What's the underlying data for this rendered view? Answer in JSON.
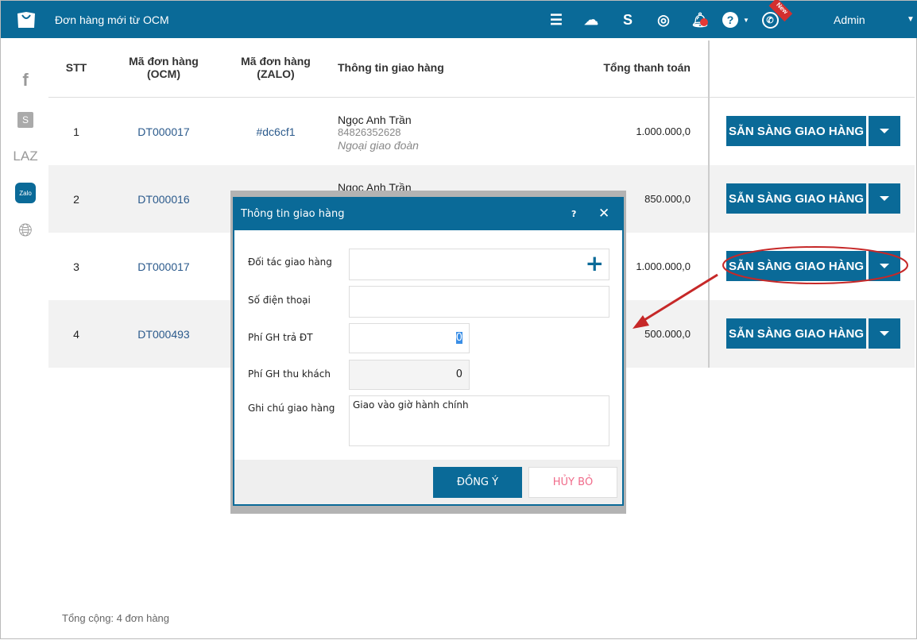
{
  "header": {
    "title": "Đơn hàng mới từ OCM",
    "user": "Admin",
    "new_badge": "New"
  },
  "sidebar": {
    "items": [
      "facebook",
      "shopee",
      "LAZ",
      "Zalo",
      "web"
    ]
  },
  "table": {
    "columns": [
      "STT",
      "Mã đơn hàng\n(OCM)",
      "Mã đơn hàng\n(ZALO)",
      "Thông tin giao hàng",
      "Tổng thanh toán"
    ],
    "rows": [
      {
        "stt": "1",
        "ocm": "DT000017",
        "zalo": "#dc6cf1",
        "name": "Ngọc Anh Trần",
        "phone": "84826352628",
        "address": "Ngoại giao đoàn",
        "total": "1.000.000,0",
        "action": "SẴN SÀNG GIAO HÀNG"
      },
      {
        "stt": "2",
        "ocm": "DT000016",
        "zalo": "",
        "name": "Ngọc Anh Trần",
        "phone": "",
        "address": "",
        "total": "850.000,0",
        "action": "SẴN SÀNG GIAO HÀNG"
      },
      {
        "stt": "3",
        "ocm": "DT000017",
        "zalo": "",
        "name": "",
        "phone": "",
        "address": "",
        "total": "1.000.000,0",
        "action": "SẴN SÀNG GIAO HÀNG"
      },
      {
        "stt": "4",
        "ocm": "DT000493",
        "zalo": "",
        "name": "",
        "phone": "",
        "address": "",
        "total": "500.000,0",
        "action": "SẴN SÀNG GIAO HÀNG"
      }
    ]
  },
  "footer": {
    "total": "Tổng cộng: 4 đơn hàng"
  },
  "modal": {
    "title": "Thông tin giao hàng",
    "help": "?",
    "close": "✕",
    "fields": {
      "partner": "Đối tác giao hàng",
      "phone": "Số điện thoại",
      "fee_partner": "Phí GH trả ĐT",
      "fee_partner_value": "0",
      "fee_customer": "Phí GH thu khách",
      "fee_customer_value": "0",
      "note": "Ghi chú giao hàng",
      "note_value": "Giao vào giờ hành chính"
    },
    "ok": "ĐỒNG Ý",
    "cancel": "HỦY BỎ"
  }
}
